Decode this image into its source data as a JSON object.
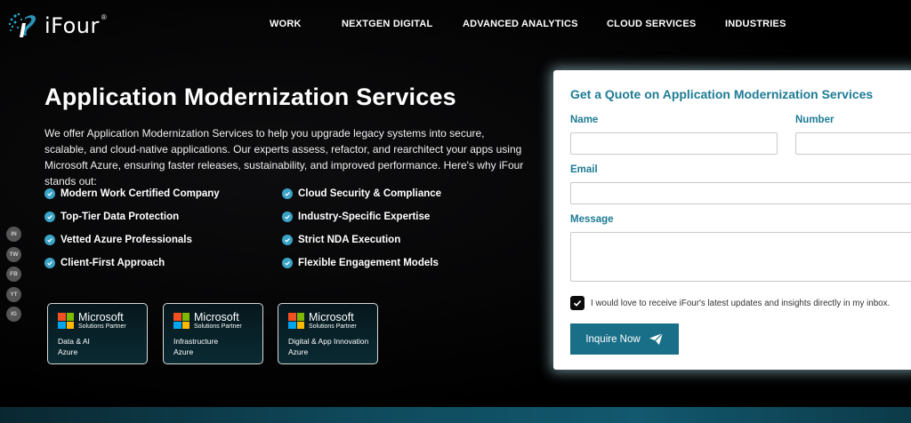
{
  "brand": {
    "name": "iFour",
    "reg": "®"
  },
  "nav": [
    "WORK",
    "NEXTGEN DIGITAL",
    "ADVANCED ANALYTICS",
    "CLOUD SERVICES",
    "INDUSTRIES"
  ],
  "hero": {
    "title": "Application Modernization Services",
    "description": "We offer Application Modernization Services to help you upgrade legacy systems into secure, scalable, and cloud-native applications. Our experts assess, refactor, and rearchitect your apps using Microsoft Azure, ensuring faster releases, sustainability, and improved performance. Here's why iFour stands out:"
  },
  "features": [
    "Modern Work Certified Company",
    "Cloud Security & Compliance",
    "Top-Tier Data Protection",
    "Industry-Specific Expertise",
    "Vetted Azure Professionals",
    "Strict NDA Execution",
    "Client-First Approach",
    "Flexible Engagement Models"
  ],
  "social": [
    "IN",
    "TW",
    "FB",
    "YT",
    "IG"
  ],
  "badges": [
    {
      "name": "Microsoft",
      "sub": "Solutions Partner",
      "line1": "Data & AI",
      "line2": "Azure"
    },
    {
      "name": "Microsoft",
      "sub": "Solutions Partner",
      "line1": "Infrastructure",
      "line2": "Azure"
    },
    {
      "name": "Microsoft",
      "sub": "Solutions Partner",
      "line1": "Digital & App Innovation",
      "line2": "Azure"
    }
  ],
  "ms_colors": [
    "#f25022",
    "#7fba00",
    "#00a4ef",
    "#ffb900"
  ],
  "form": {
    "title": "Get a Quote on Application Modernization Services",
    "name_label": "Name",
    "number_label": "Number",
    "email_label": "Email",
    "message_label": "Message",
    "name_value": "",
    "number_value": "",
    "email_value": "",
    "message_value": "",
    "consent_text": "I would love to receive iFour's latest updates and insights directly in my inbox.",
    "consent_checked": true,
    "submit_label": "Inquire Now"
  },
  "colors": {
    "accent": "#1d7b95",
    "button": "#1a6f88",
    "check": "#3aa3c6"
  }
}
